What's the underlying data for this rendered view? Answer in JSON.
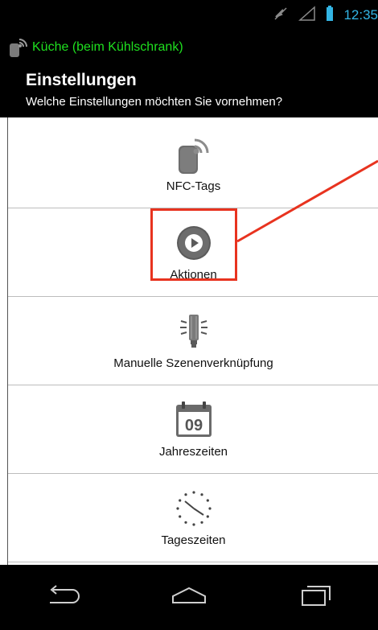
{
  "status_bar": {
    "time": "12:35",
    "icons": [
      "mute-icon",
      "signal-icon",
      "battery-icon"
    ],
    "time_color": "#33b5e5"
  },
  "app_bar": {
    "title": "Küche (beim Kühlschrank)",
    "title_color": "#1fe01f",
    "icon": "nfc-phone-icon"
  },
  "header": {
    "title": "Einstellungen",
    "subtitle": "Welche Einstellungen möchten Sie vornehmen?"
  },
  "items": [
    {
      "label": "NFC-Tags",
      "icon": "nfc-tag-icon"
    },
    {
      "label": "Aktionen",
      "icon": "play-icon",
      "highlighted": true
    },
    {
      "label": "Manuelle Szenenverknüpfung",
      "icon": "bulb-icon"
    },
    {
      "label": "Jahreszeiten",
      "icon": "calendar-icon",
      "icon_text": "09"
    },
    {
      "label": "Tageszeiten",
      "icon": "clock-icon"
    }
  ],
  "annotation": {
    "color": "#e8331f"
  },
  "nav_bar": {
    "buttons": [
      "back-icon",
      "home-icon",
      "recents-icon"
    ]
  }
}
